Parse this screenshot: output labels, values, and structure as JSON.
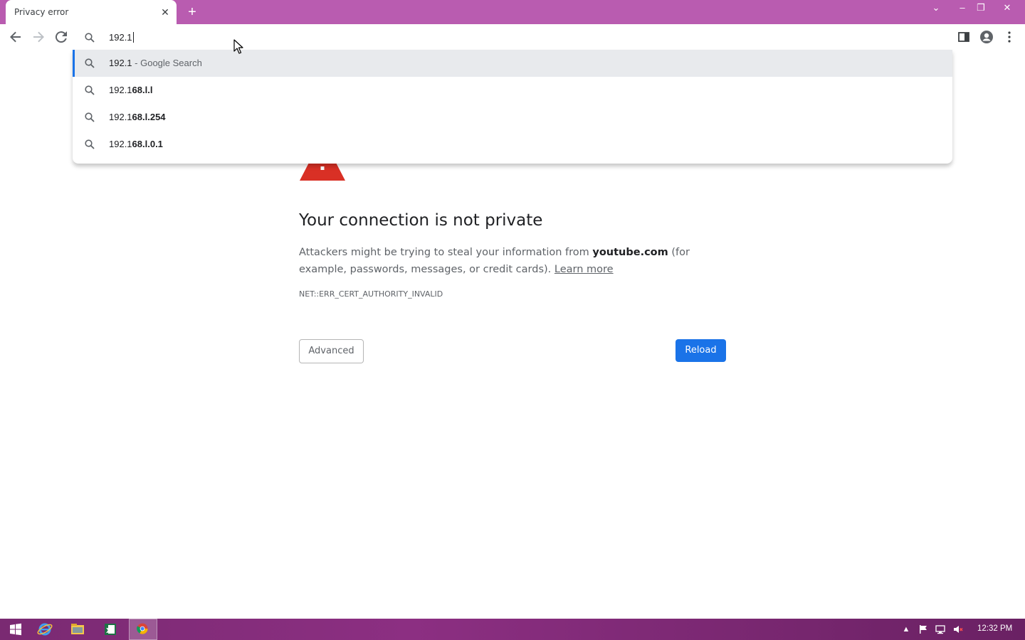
{
  "tab": {
    "title": "Privacy error",
    "close_glyph": "✕",
    "new_tab_glyph": "+"
  },
  "window_controls": {
    "dropdown": "⌄",
    "minimize": "–",
    "restore": "❐",
    "close": "✕"
  },
  "omnibox": {
    "value": "192.1"
  },
  "suggestions": [
    {
      "prefix": "192.1",
      "bold": "",
      "description": " - Google Search",
      "icon": "search-icon"
    },
    {
      "prefix": "192.1",
      "bold": "68.l.l",
      "description": "",
      "icon": "search-icon"
    },
    {
      "prefix": "192.1",
      "bold": "68.l.254",
      "description": "",
      "icon": "search-icon"
    },
    {
      "prefix": "192.1",
      "bold": "68.l.0.1",
      "description": "",
      "icon": "search-icon"
    }
  ],
  "page": {
    "title": "Your connection is not private",
    "desc_before": "Attackers might be trying to steal your information from ",
    "domain": "youtube.com",
    "desc_after": " (for example, passwords, messages, or credit cards). ",
    "learn_more": "Learn more",
    "error_code": "NET::ERR_CERT_AUTHORITY_INVALID",
    "advanced_label": "Advanced",
    "reload_label": "Reload"
  },
  "taskbar": {
    "time": "12:32 PM"
  },
  "colors": {
    "titlebar": "#b95cb0",
    "accent": "#1a73e8",
    "warning": "#d93025",
    "taskbar": "#7a2a72"
  }
}
